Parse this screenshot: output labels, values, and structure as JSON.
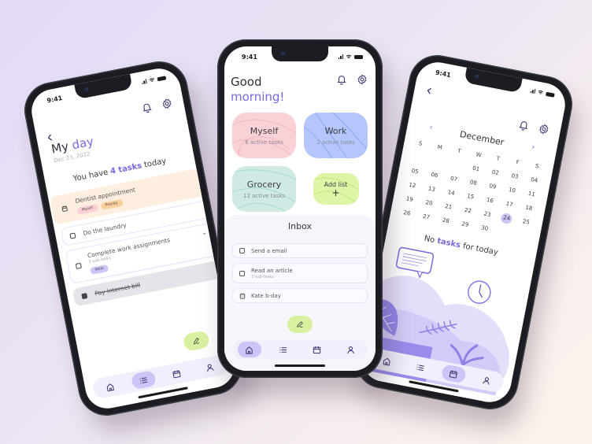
{
  "colors": {
    "accent": "#7a68e0",
    "myself_card": "#fbd1d8",
    "work_card": "#b4c6fb",
    "grocery_card": "#cfeae4",
    "add_card": "#def5a8",
    "fab": "#d9f0a0",
    "nav_active": "#cdc4f7",
    "tag_myself": "#fbd1d8",
    "tag_priority": "#fbcf9c",
    "tag_work": "#cdc4f7"
  },
  "status_bar": {
    "time": "9:41"
  },
  "home_screen": {
    "greeting_line1": "Good",
    "greeting_line2": "morning!",
    "lists": [
      {
        "name": "Myself",
        "subtitle": "6 active tasks"
      },
      {
        "name": "Work",
        "subtitle": "2 active tasks"
      },
      {
        "name": "Grocery",
        "subtitle": "12 active tasks"
      }
    ],
    "add_list": {
      "label": "Add list",
      "icon": "+"
    },
    "inbox": {
      "title": "Inbox",
      "tasks": [
        {
          "title": "Send a email",
          "subtitle": "",
          "icon": "checkbox"
        },
        {
          "title": "Read an article",
          "subtitle": "3 sub-tasks",
          "icon": "checkbox"
        },
        {
          "title": "Kate b-day",
          "subtitle": "",
          "icon": "calendar"
        }
      ]
    },
    "nav": [
      "home",
      "list",
      "calendar",
      "profile"
    ],
    "nav_active": "home"
  },
  "day_screen": {
    "title_plain": "My",
    "title_accent": "day",
    "date": "Dec 23, 2022",
    "summary_pre": "You have",
    "summary_accent": "4 tasks",
    "summary_post": "today",
    "tasks": [
      {
        "title": "Dentist appointment",
        "tags": [
          "Myself",
          "Priority"
        ],
        "icon": "calendar"
      },
      {
        "title": "Do the laundry"
      },
      {
        "title": "Complete work assignments",
        "subtitle": "3 sub-tasks",
        "tags": [
          "Work"
        ]
      },
      {
        "title": "Pay internet bill",
        "done": true
      }
    ],
    "nav_active": "list"
  },
  "calendar_screen": {
    "month": "December",
    "weekdays": [
      "S",
      "M",
      "T",
      "W",
      "T",
      "F",
      "S"
    ],
    "days": [
      "",
      "",
      "",
      "01",
      "02",
      "03",
      "04",
      "05",
      "06",
      "07",
      "08",
      "09",
      "10",
      "11",
      "12",
      "13",
      "14",
      "15",
      "16",
      "17",
      "18",
      "19",
      "20",
      "21",
      "22",
      "23",
      "24",
      "25",
      "26",
      "27",
      "28",
      "29",
      "30",
      "",
      ""
    ],
    "selected_day": "24",
    "empty_pre": "No",
    "empty_accent": "tasks",
    "empty_post": "for today",
    "nav_active": "calendar"
  }
}
